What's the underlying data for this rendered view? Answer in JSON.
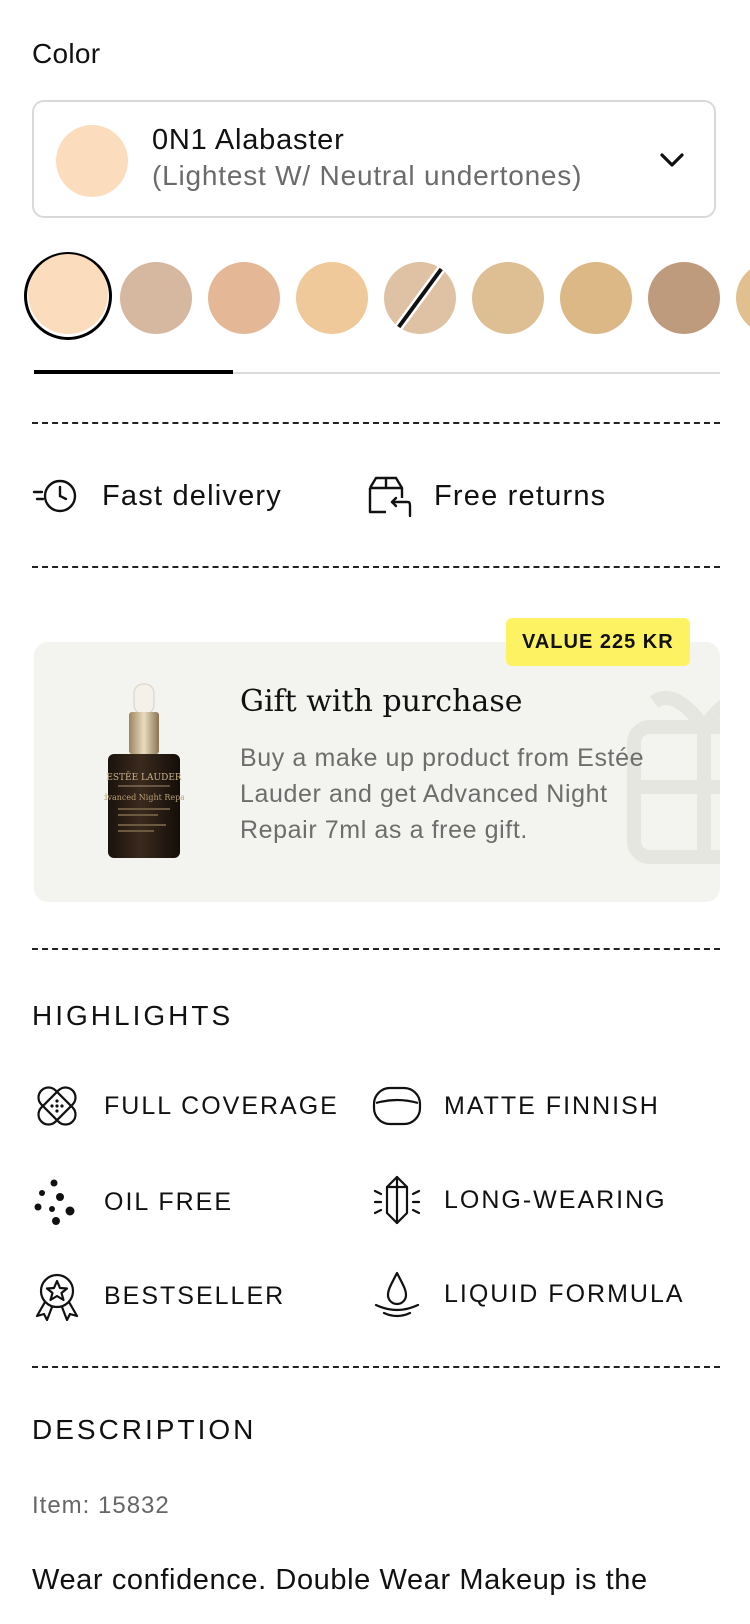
{
  "color_section": {
    "label": "Color",
    "selected_shade": {
      "name": "0N1 Alabaster",
      "description": "(Lightest W/ Neutral undertones)",
      "color": "#fbdcbd"
    },
    "swatches": [
      {
        "color": "#fbdcbd",
        "selected": true,
        "unavailable": false
      },
      {
        "color": "#d6b8a1",
        "selected": false,
        "unavailable": false
      },
      {
        "color": "#e4b896",
        "selected": false,
        "unavailable": false
      },
      {
        "color": "#efc99a",
        "selected": false,
        "unavailable": false
      },
      {
        "color": "#dfc2a3",
        "selected": false,
        "unavailable": true
      },
      {
        "color": "#ddbf93",
        "selected": false,
        "unavailable": false
      },
      {
        "color": "#dcb887",
        "selected": false,
        "unavailable": false
      },
      {
        "color": "#bf9b7e",
        "selected": false,
        "unavailable": false
      },
      {
        "color": "#e2bf8e",
        "selected": false,
        "unavailable": false
      }
    ],
    "scroll_progress": 0.29
  },
  "usps": {
    "fast_delivery": "Fast delivery",
    "free_returns": "Free returns"
  },
  "gift": {
    "badge": "VALUE 225 KR",
    "title": "Gift with purchase",
    "text": "Buy a make up product from Estée Lauder and get Advanced Night Repair 7ml as a free gift.",
    "bottle_brand": "ESTĒE LAUDER",
    "bottle_product": "Advanced Night Repair",
    "badge_color": "#fdf261",
    "background_color": "#f3f3ef"
  },
  "highlights": {
    "title": "HIGHLIGHTS",
    "items": [
      {
        "label": "FULL COVERAGE",
        "icon": "bandage-icon"
      },
      {
        "label": "MATTE FINNISH",
        "icon": "matte-icon"
      },
      {
        "label": "OIL FREE",
        "icon": "dots-icon"
      },
      {
        "label": "LONG-WEARING",
        "icon": "crystal-icon"
      },
      {
        "label": "BESTSELLER",
        "icon": "award-star-icon"
      },
      {
        "label": "LIQUID FORMULA",
        "icon": "droplet-icon"
      }
    ]
  },
  "description": {
    "title": "DESCRIPTION",
    "item_number": "Item: 15832",
    "text": "Wear confidence. Double Wear Makeup is the"
  }
}
